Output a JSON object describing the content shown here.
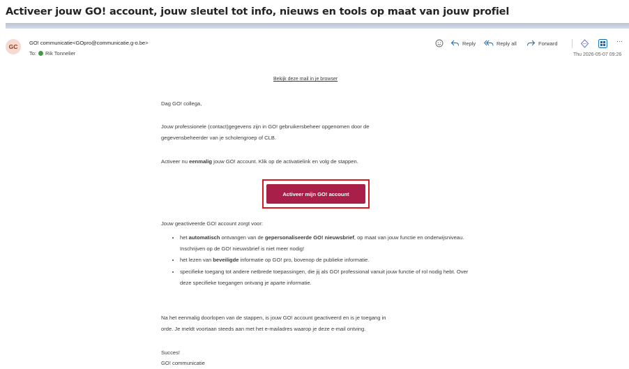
{
  "subject": "Activeer jouw GO! account, jouw sleutel tot info, nieuws en tools op maat van jouw profiel",
  "sender": {
    "initials": "GC",
    "from": "GO! communicatie<GOpro@communicatie.g-o.be>",
    "to_label": "To:",
    "to_name": "Rik Tonnelier",
    "date": "Thu 2026-05-07 09:26"
  },
  "toolbar": {
    "reply": "Reply",
    "reply_all": "Reply all",
    "forward": "Forward",
    "more": "···"
  },
  "email": {
    "view_in_browser": "Bekijk deze mail in je browser",
    "greeting": "Dag GO! collega,",
    "para1_line1": "Jouw professionele (contact)gegevens zijn in GO! gebruikersbeheer opgenomen door de",
    "para1_line2": "gegevensbeheerder van je scholengroep of CLB.",
    "para2_pre": "Activeer nu ",
    "para2_bold": "eenmalig",
    "para2_post": " jouw GO! account. Klik op de activatielink en volg de stappen.",
    "cta": "Activeer mijn GO! account",
    "intro_list": "Jouw geactiveerde GO! account zorgt voor:",
    "b1_pre": "het ",
    "b1_bold1": "automatisch",
    "b1_mid": " ontvangen van de ",
    "b1_bold2": "gepersonaliseerde GO! nieuwsbrief",
    "b1_post": ", op maat van jouw functie en onderwijsniveau. Inschrijven op de GO! nieuwsbrief is niet meer nodig!",
    "b2_pre": "het lezen van ",
    "b2_bold": "beveiligde",
    "b2_post": " informatie op GO! pro, bovenop de publieke informatie.",
    "b3": "specifieke toegang tot andere netbrede toepassingen, die jij als GO! professional vanuit jouw functie of rol nodig hebt. Over deze specifieke toegangen ontvang je aparte informatie.",
    "para3_line1": "Na het eenmalig doorlopen van de stappen, is jouw GO! account geactiveerd en is je toegang in",
    "para3_line2": "orde. Je meldt voortaan steeds aan met het e-mailadres waarop je deze e-mail ontving.",
    "signoff": "Succes!",
    "signature": "GO! communicatie"
  },
  "colors": {
    "cta_bg": "#a8204a",
    "highlight_border": "#e0141e",
    "accent_blue": "#0f6cbd"
  }
}
